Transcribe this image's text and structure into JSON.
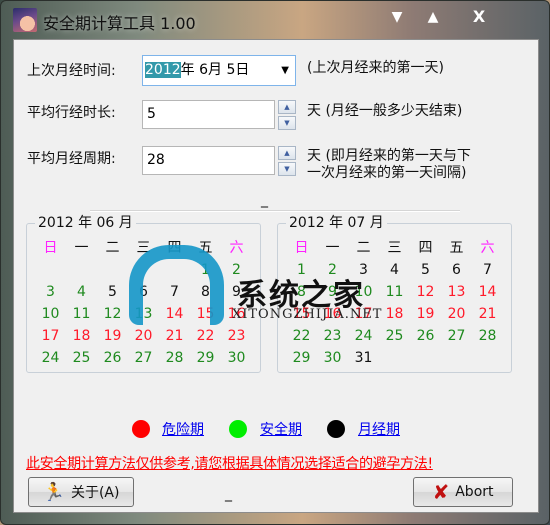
{
  "window": {
    "title": "安全期计算工具 1.00",
    "controls": {
      "minimize": "▼",
      "maximize": "▲",
      "close": "X"
    }
  },
  "form": {
    "last_period": {
      "label": "上次月经时间:",
      "year": "2012",
      "rest": "年  6月  5日",
      "hint": "(上次月经来的第一天)"
    },
    "duration": {
      "label": "平均行经时长:",
      "value": "5",
      "hint": "天 (月经一般多少天结束)"
    },
    "cycle": {
      "label": "平均月经周期:",
      "value": "28",
      "hint_line1": "天 (即月经来的第一天与下",
      "hint_line2": "一次月经来的第一天间隔)"
    },
    "dash": "_"
  },
  "colors": {
    "danger": "#ff1a2a",
    "safe": "#1f8a1f",
    "period": "#111111",
    "weekend_header": "#ff22ff",
    "link": "#0000ee",
    "warning": "#ff0000"
  },
  "weekdays": [
    "日",
    "一",
    "二",
    "三",
    "四",
    "五",
    "六"
  ],
  "calendars": [
    {
      "caption": "2012 年 06 月",
      "offset": 5,
      "days": [
        {
          "d": "1",
          "t": "safe"
        },
        {
          "d": "2",
          "t": "safe"
        },
        {
          "d": "3",
          "t": "safe"
        },
        {
          "d": "4",
          "t": "safe"
        },
        {
          "d": "5",
          "t": "period"
        },
        {
          "d": "6",
          "t": "period"
        },
        {
          "d": "7",
          "t": "period"
        },
        {
          "d": "8",
          "t": "period"
        },
        {
          "d": "9",
          "t": "period"
        },
        {
          "d": "10",
          "t": "safe"
        },
        {
          "d": "11",
          "t": "safe"
        },
        {
          "d": "12",
          "t": "safe"
        },
        {
          "d": "13",
          "t": "safe"
        },
        {
          "d": "14",
          "t": "danger"
        },
        {
          "d": "15",
          "t": "danger"
        },
        {
          "d": "16",
          "t": "danger"
        },
        {
          "d": "17",
          "t": "danger"
        },
        {
          "d": "18",
          "t": "danger"
        },
        {
          "d": "19",
          "t": "danger"
        },
        {
          "d": "20",
          "t": "danger"
        },
        {
          "d": "21",
          "t": "danger"
        },
        {
          "d": "22",
          "t": "danger"
        },
        {
          "d": "23",
          "t": "danger"
        },
        {
          "d": "24",
          "t": "safe"
        },
        {
          "d": "25",
          "t": "safe"
        },
        {
          "d": "26",
          "t": "safe"
        },
        {
          "d": "27",
          "t": "safe"
        },
        {
          "d": "28",
          "t": "safe"
        },
        {
          "d": "29",
          "t": "safe"
        },
        {
          "d": "30",
          "t": "safe"
        }
      ]
    },
    {
      "caption": "2012 年 07 月",
      "offset": 0,
      "days": [
        {
          "d": "1",
          "t": "safe"
        },
        {
          "d": "2",
          "t": "safe"
        },
        {
          "d": "3",
          "t": "period"
        },
        {
          "d": "4",
          "t": "period"
        },
        {
          "d": "5",
          "t": "period"
        },
        {
          "d": "6",
          "t": "period"
        },
        {
          "d": "7",
          "t": "period"
        },
        {
          "d": "8",
          "t": "safe"
        },
        {
          "d": "9",
          "t": "safe"
        },
        {
          "d": "10",
          "t": "safe"
        },
        {
          "d": "11",
          "t": "safe"
        },
        {
          "d": "12",
          "t": "danger"
        },
        {
          "d": "13",
          "t": "danger"
        },
        {
          "d": "14",
          "t": "danger"
        },
        {
          "d": "15",
          "t": "danger"
        },
        {
          "d": "16",
          "t": "danger"
        },
        {
          "d": "17",
          "t": "danger"
        },
        {
          "d": "18",
          "t": "danger"
        },
        {
          "d": "19",
          "t": "danger"
        },
        {
          "d": "20",
          "t": "danger"
        },
        {
          "d": "21",
          "t": "danger"
        },
        {
          "d": "22",
          "t": "safe"
        },
        {
          "d": "23",
          "t": "safe"
        },
        {
          "d": "24",
          "t": "safe"
        },
        {
          "d": "25",
          "t": "safe"
        },
        {
          "d": "26",
          "t": "safe"
        },
        {
          "d": "27",
          "t": "safe"
        },
        {
          "d": "28",
          "t": "safe"
        },
        {
          "d": "29",
          "t": "safe"
        },
        {
          "d": "30",
          "t": "safe"
        },
        {
          "d": "31",
          "t": "period"
        }
      ]
    }
  ],
  "legend": {
    "danger": {
      "label": "危险期",
      "color": "#ff0000"
    },
    "safe": {
      "label": "安全期",
      "color": "#00ee00"
    },
    "period": {
      "label": "月经期",
      "color": "#000000"
    }
  },
  "warning": "此安全期计算方法仅供参考,请您根据具体情况选择适合的避孕方法!",
  "buttons": {
    "about": "关于(A)",
    "abort": "Abort",
    "bottom_dash": "_"
  },
  "watermark": {
    "text": "系统之家",
    "sub": "XITONGZHIJIA.NET"
  }
}
